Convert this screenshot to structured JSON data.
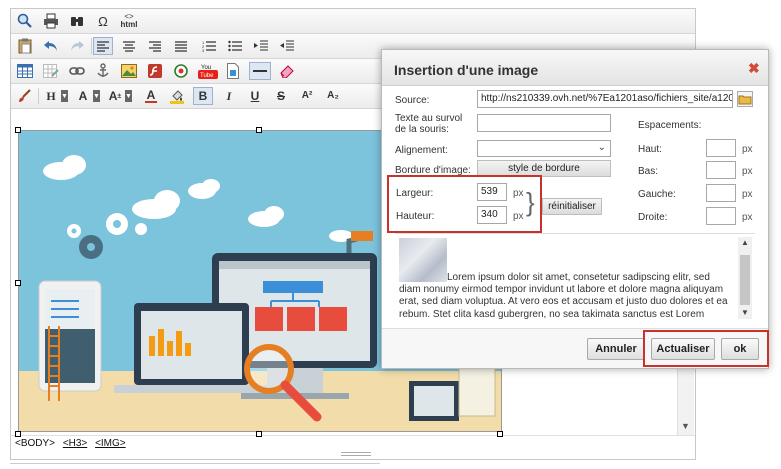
{
  "toolbar": {
    "row3_text": {
      "youtube": "You Tube"
    },
    "row1": {
      "html_label": "html",
      "html_code": "<>",
      "omega": "Ω"
    },
    "row4": {
      "heading": "H",
      "font": "A",
      "size": "A",
      "size_sup": "±",
      "color_a": "A",
      "bold": "B",
      "italic": "I",
      "underline": "U",
      "strike": "S",
      "superscript": "A²",
      "subscript": "A₂"
    }
  },
  "status_bar": {
    "body": "<BODY>",
    "h3": "<H3>",
    "img": "<IMG>"
  },
  "dialog": {
    "title": "Insertion d'une image",
    "source_label": "Source:",
    "source_value": "http://ns210339.ovh.net/%7Ea1201aso/fichiers_site/a120",
    "hover_label_1": "Texte au survol",
    "hover_label_2": "de la souris:",
    "hover_value": "",
    "align_label": "Alignement:",
    "align_value": "",
    "border_label": "Bordure d'image:",
    "border_style_button": "style de bordure",
    "width_label": "Largeur:",
    "width_value": "539",
    "height_label": "Hauteur:",
    "height_value": "340",
    "px": "px",
    "reset_button": "réinitialiser",
    "spacing_label": "Espacements:",
    "top_label": "Haut:",
    "bottom_label": "Bas:",
    "left_label": "Gauche:",
    "right_label": "Droite:",
    "spacing_top": "",
    "spacing_bottom": "",
    "spacing_left": "",
    "spacing_right": "",
    "preview_text": "Lorem ipsum dolor sit amet, consetetur sadipscing elitr, sed diam nonumy eirmod tempor invidunt ut labore et dolore magna aliquyam erat, sed diam voluptua. At vero eos et accusam et justo duo dolores et ea rebum. Stet clita kasd gubergren, no sea takimata sanctus est Lorem ipsum dolor sit amet.",
    "cancel_button": "Annuler",
    "update_button": "Actualiser",
    "ok_button": "ok"
  },
  "colors": {
    "highlight_red": "#c7332a",
    "sky": "#7cc3dc",
    "floor": "#f1dcaa",
    "bar_orange": "#f39c12"
  }
}
